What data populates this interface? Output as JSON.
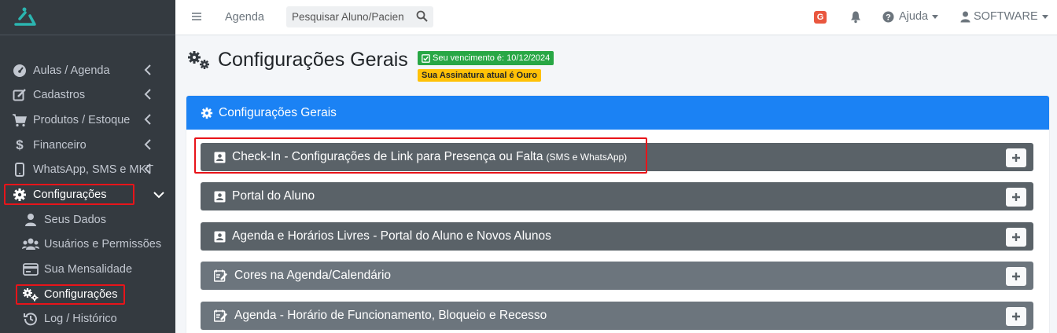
{
  "colors": {
    "sidebar_bg": "#343a40",
    "primary": "#1b82f4",
    "accordion_bg": "#5a6268",
    "success": "#28a745",
    "warning": "#ffc107",
    "highlight": "#e8141a"
  },
  "sidebar": {
    "logo": "logo-icon",
    "items": [
      {
        "label": "Aulas / Agenda",
        "icon": "tachometer-icon"
      },
      {
        "label": "Cadastros",
        "icon": "edit-icon"
      },
      {
        "label": "Produtos / Estoque",
        "icon": "cart-icon"
      },
      {
        "label": "Financeiro",
        "icon": "dollar-icon"
      },
      {
        "label": "WhatsApp, SMS e MKT",
        "icon": "mobile-icon"
      },
      {
        "label": "Configurações",
        "icon": "gear-icon"
      }
    ],
    "subitems": [
      {
        "label": "Seus Dados",
        "icon": "user-icon"
      },
      {
        "label": "Usuários e Permissões",
        "icon": "users-icon"
      },
      {
        "label": "Sua Mensalidade",
        "icon": "card-icon"
      },
      {
        "label": "Configurações",
        "icon": "gears-icon"
      },
      {
        "label": "Log / Histórico",
        "icon": "history-icon"
      }
    ]
  },
  "topbar": {
    "agenda": "Agenda",
    "search_placeholder": "Pesquisar Aluno/Paciente",
    "g_badge": "G",
    "help": "Ajuda",
    "user": "SOFTWARE"
  },
  "page": {
    "title": "Configurações Gerais",
    "expiry_badge": "Seu vencimento é: 10/12/2024",
    "plan_badge": "Sua Assinatura atual é Ouro"
  },
  "card": {
    "title": "Configurações Gerais",
    "sections": [
      {
        "label": "Check-In - Configurações de Link para Presença ou Falta",
        "note": "(SMS e WhatsApp)"
      },
      {
        "label": "Portal do Aluno",
        "note": ""
      },
      {
        "label": "Agenda e Horários Livres - Portal do Aluno e Novos Alunos",
        "note": ""
      },
      {
        "label": "Cores na Agenda/Calendário",
        "note": ""
      },
      {
        "label": "Agenda - Horário de Funcionamento, Bloqueio e Recesso",
        "note": ""
      }
    ]
  }
}
